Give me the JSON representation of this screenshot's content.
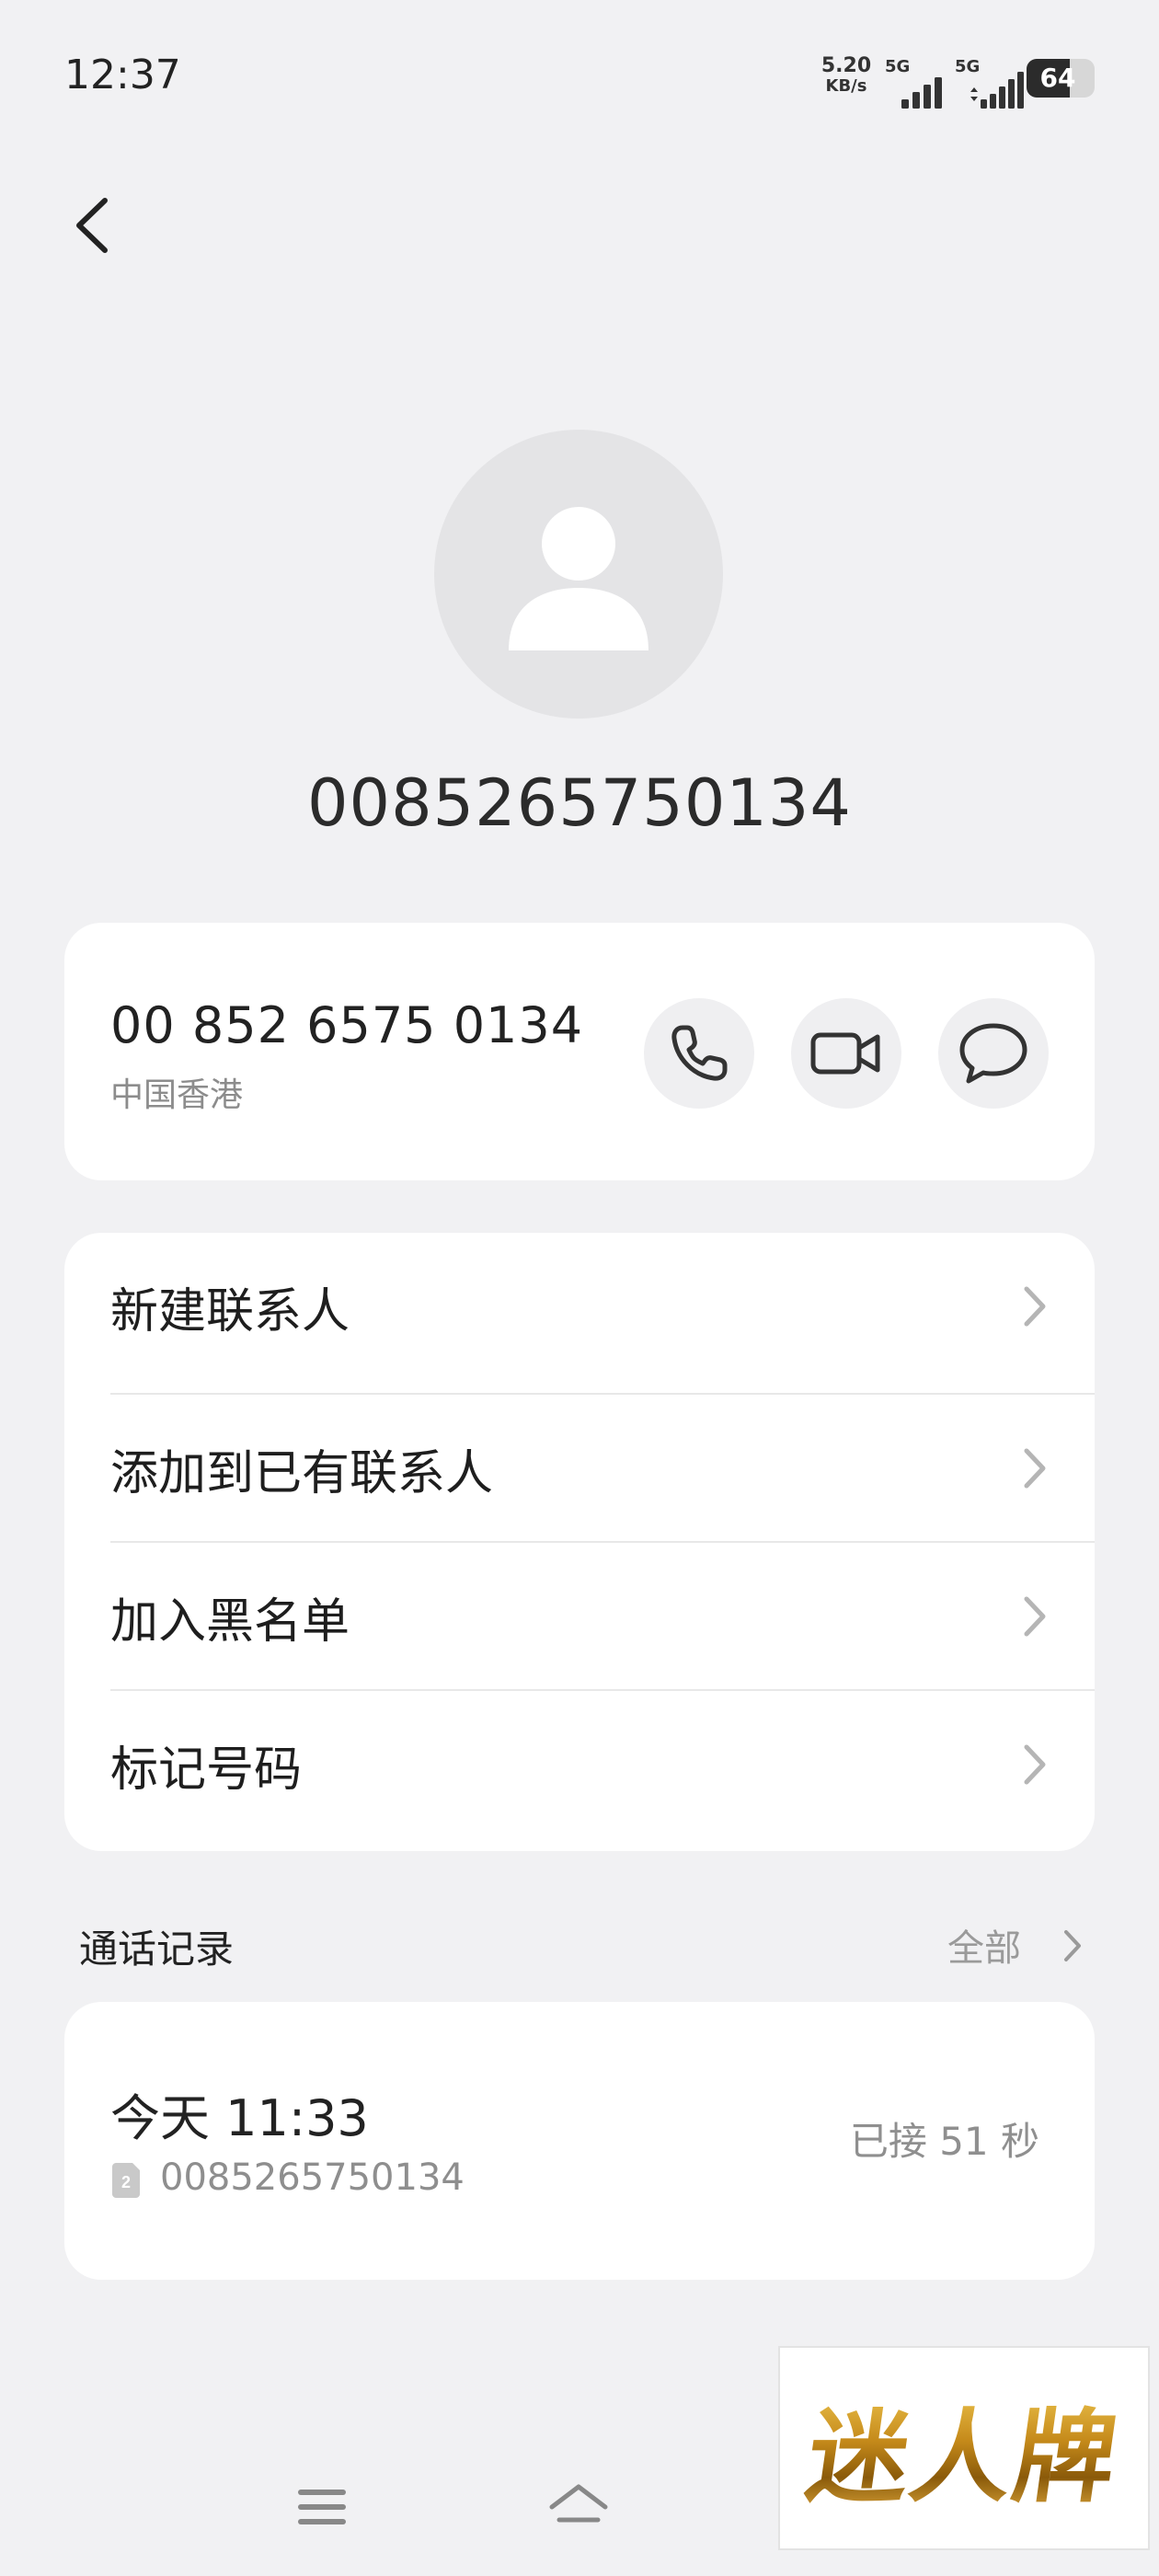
{
  "status_bar": {
    "time": "12:37",
    "net_speed_value": "5.20",
    "net_speed_unit": "KB/s",
    "sim1_label": "5G",
    "sim2_label": "5G",
    "battery": "64",
    "battery_level": 0.64
  },
  "contact": {
    "title_number": "0085265750134",
    "formatted_number": "00 852 6575 0134",
    "region": "中国香港"
  },
  "actions": [
    {
      "label": "新建联系人"
    },
    {
      "label": "添加到已有联系人"
    },
    {
      "label": "加入黑名单"
    },
    {
      "label": "标记号码"
    }
  ],
  "call_log": {
    "section_title": "通话记录",
    "see_all": "全部",
    "entries": [
      {
        "time": "今天 11:33",
        "sim": "2",
        "number": "0085265750134",
        "status": "已接 51 秒"
      }
    ]
  },
  "watermark": {
    "text": "迷人牌"
  },
  "icons": {
    "back": "back-arrow-icon",
    "avatar": "person-icon",
    "call": "phone-icon",
    "video": "video-camera-icon",
    "message": "message-bubble-icon",
    "chevron": "chevron-right-icon",
    "menu": "menu-icon",
    "home": "home-icon"
  },
  "colors": {
    "background": "#f1f1f3",
    "card": "#ffffff",
    "secondary_text": "#8c8c8c"
  }
}
